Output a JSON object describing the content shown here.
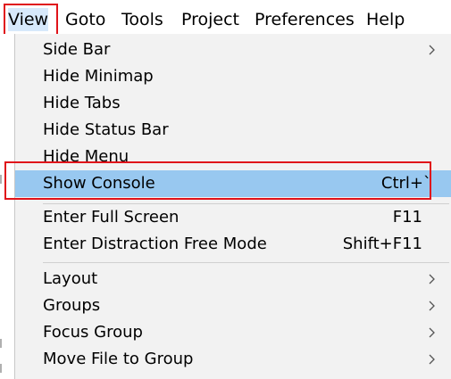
{
  "menubar": {
    "items": [
      "View",
      "Goto",
      "Tools",
      "Project",
      "Preferences",
      "Help"
    ]
  },
  "view_menu": {
    "items": [
      {
        "label": "Side Bar",
        "shortcut": "",
        "submenu": true
      },
      {
        "label": "Hide Minimap",
        "shortcut": "",
        "submenu": false
      },
      {
        "label": "Hide Tabs",
        "shortcut": "",
        "submenu": false
      },
      {
        "label": "Hide Status Bar",
        "shortcut": "",
        "submenu": false
      },
      {
        "label": "Hide Menu",
        "shortcut": "",
        "submenu": false
      },
      {
        "label": "Show Console",
        "shortcut": "Ctrl+`",
        "submenu": false,
        "selected": true
      },
      {
        "label": "Enter Full Screen",
        "shortcut": "F11",
        "submenu": false
      },
      {
        "label": "Enter Distraction Free Mode",
        "shortcut": "Shift+F11",
        "submenu": false
      },
      {
        "label": "Layout",
        "shortcut": "",
        "submenu": true
      },
      {
        "label": "Groups",
        "shortcut": "",
        "submenu": true
      },
      {
        "label": "Focus Group",
        "shortcut": "",
        "submenu": true
      },
      {
        "label": "Move File to Group",
        "shortcut": "",
        "submenu": true
      }
    ]
  },
  "colors": {
    "highlight_box": "#e0131a",
    "selected_row": "#98c8f0",
    "menu_bg": "#f2f2f2"
  },
  "icons": {
    "submenu_arrow": "chevron-right-icon"
  }
}
